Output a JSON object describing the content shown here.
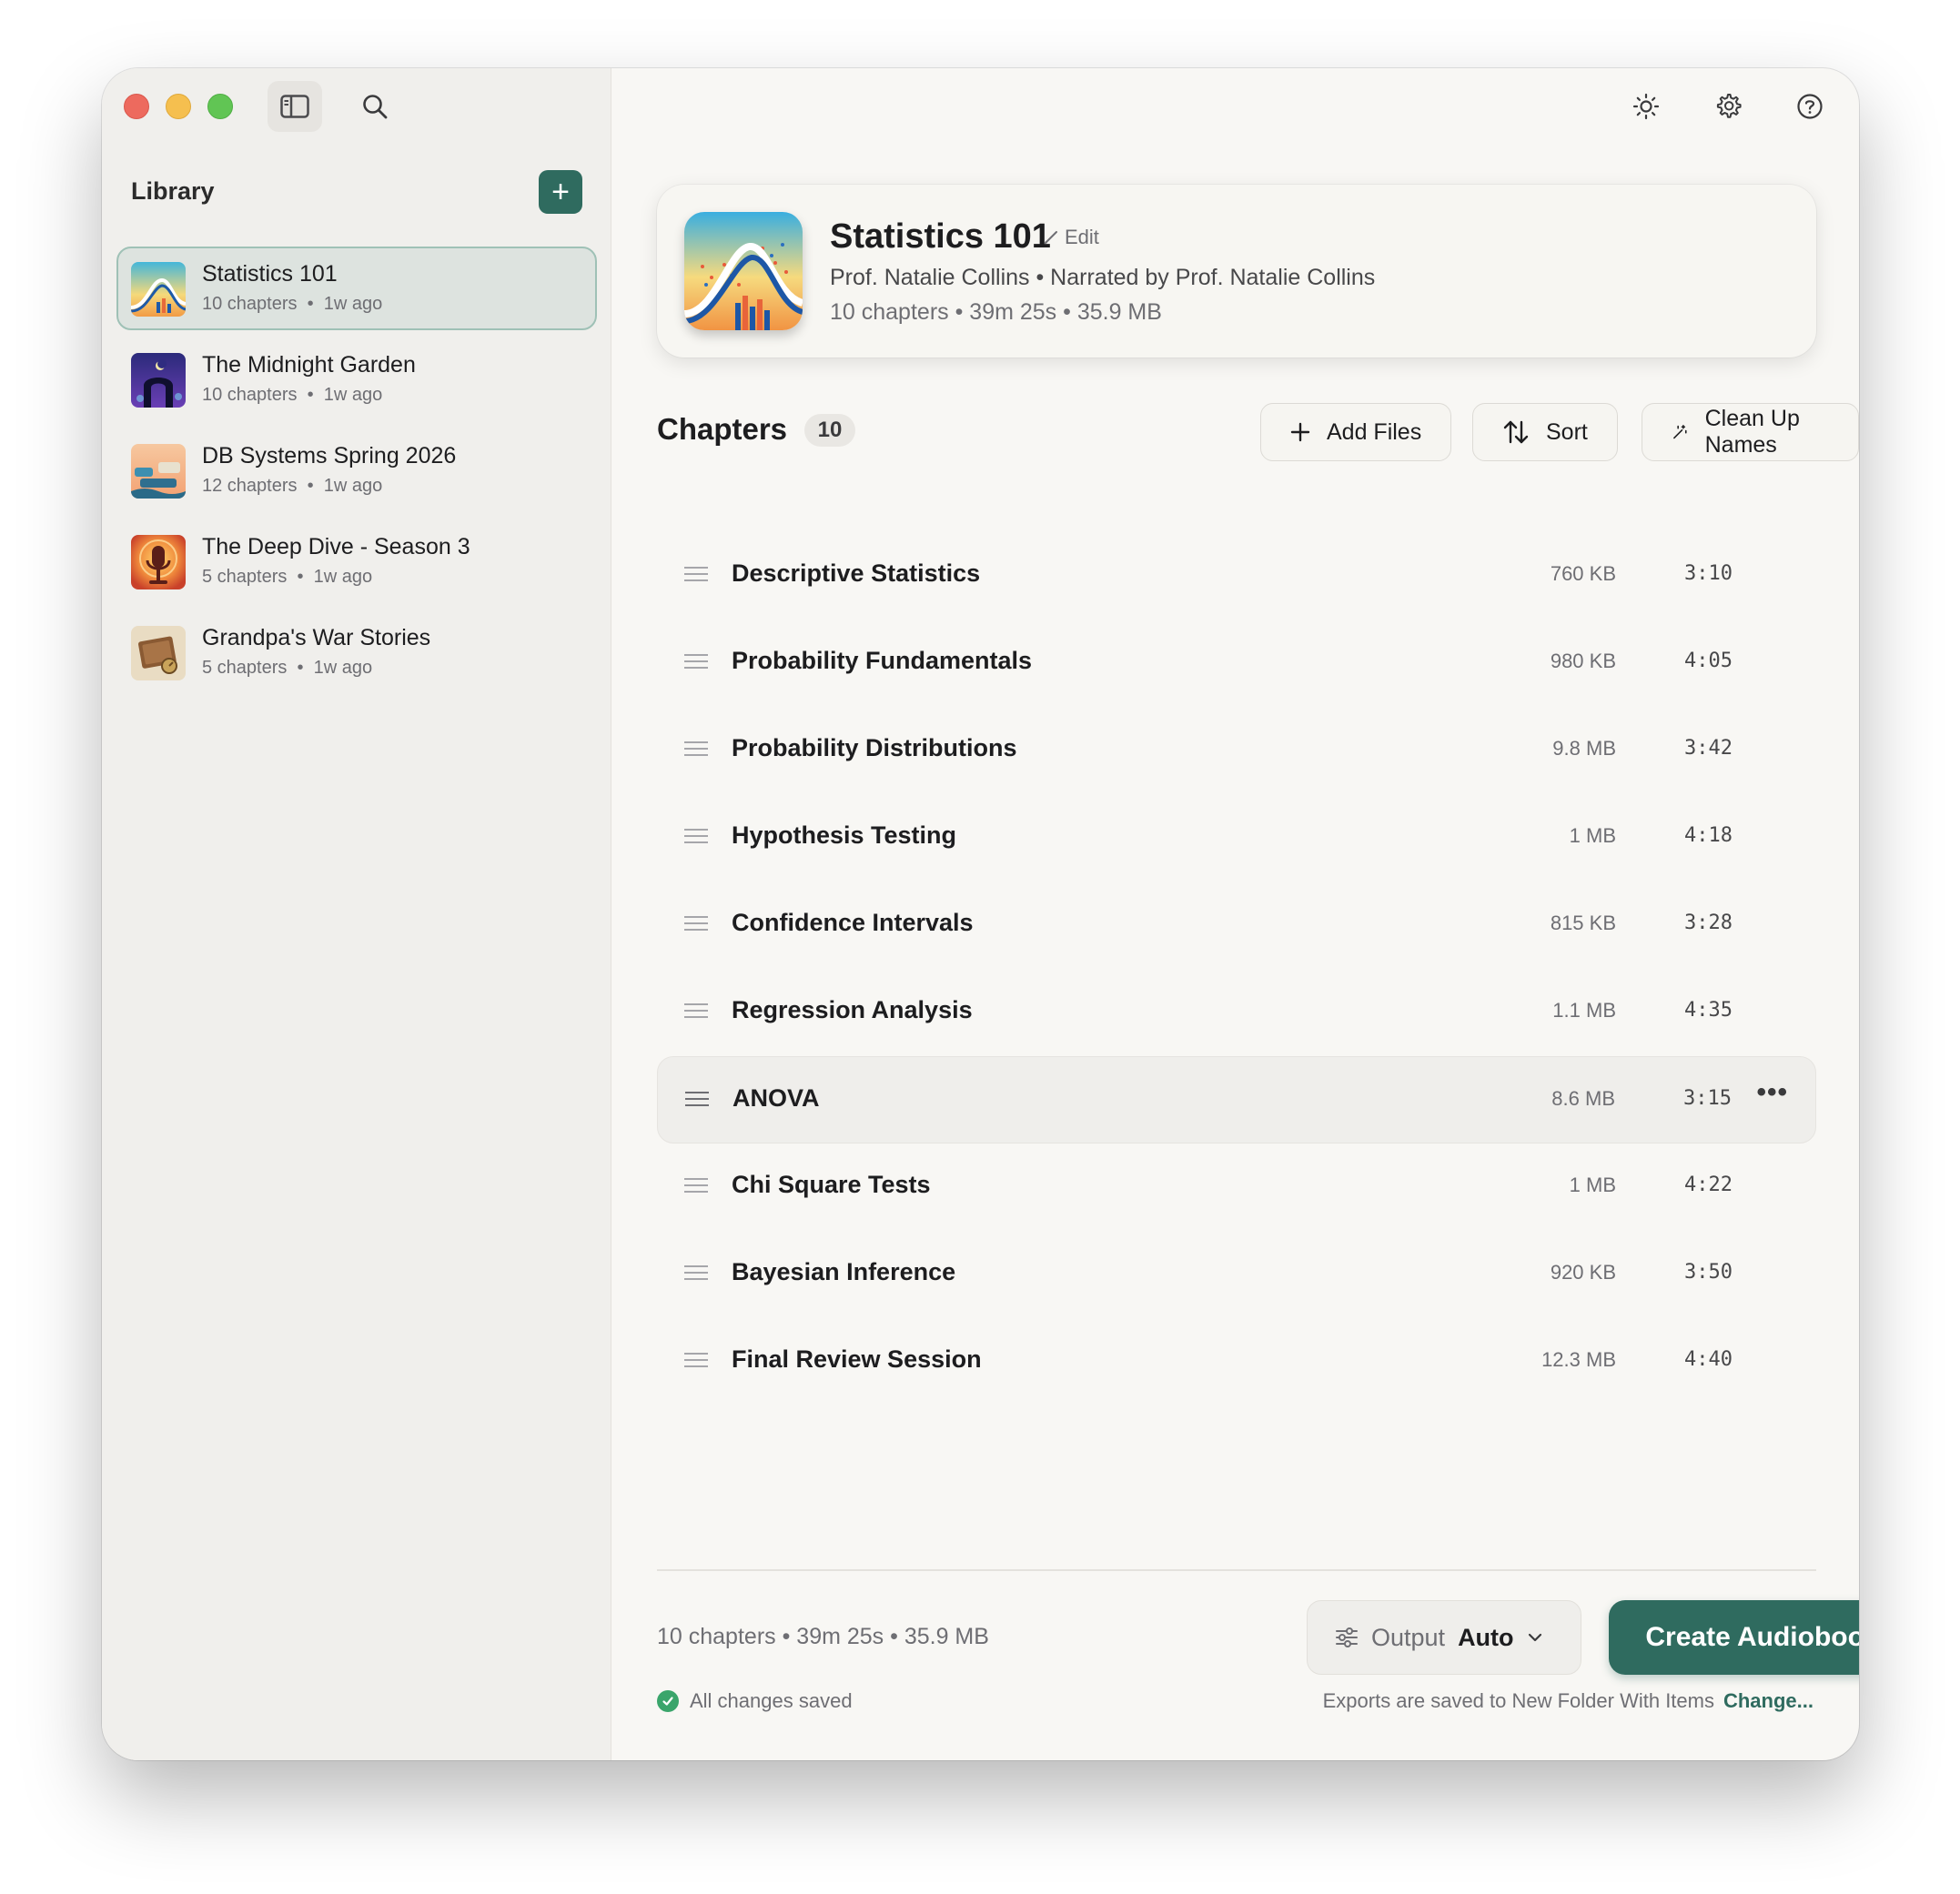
{
  "window": {
    "traffic_lights": [
      "close",
      "minimize",
      "zoom"
    ]
  },
  "toolbar": {
    "sidebar_icon": "sidebar-icon",
    "search_icon": "search-icon",
    "right_icons": [
      "sun-icon",
      "gear-icon",
      "help-icon"
    ]
  },
  "library": {
    "title": "Library",
    "add_label": "+",
    "items": [
      {
        "name": "Statistics 101",
        "chapters": "10 chapters",
        "when": "1w ago",
        "selected": true
      },
      {
        "name": "The Midnight Garden",
        "chapters": "10 chapters",
        "when": "1w ago"
      },
      {
        "name": "DB Systems Spring 2026",
        "chapters": "12 chapters",
        "when": "1w ago"
      },
      {
        "name": "The Deep Dive - Season 3",
        "chapters": "5 chapters",
        "when": "1w ago"
      },
      {
        "name": "Grandpa's War Stories",
        "chapters": "5 chapters",
        "when": "1w ago"
      }
    ]
  },
  "book": {
    "title": "Statistics 101",
    "edit_label": "Edit",
    "authors": "Prof. Natalie Collins • Narrated by Prof. Natalie Collins",
    "meta": "10 chapters • 39m 25s • 35.9 MB"
  },
  "chapters": {
    "heading": "Chapters",
    "count": "10",
    "add_files": "Add Files",
    "sort": "Sort",
    "clean_up": "Clean Up Names",
    "rows": [
      {
        "title": "Descriptive Statistics",
        "size": "760 KB",
        "duration": "3:10"
      },
      {
        "title": "Probability Fundamentals",
        "size": "980 KB",
        "duration": "4:05"
      },
      {
        "title": "Probability Distributions",
        "size": "9.8 MB",
        "duration": "3:42"
      },
      {
        "title": "Hypothesis Testing",
        "size": "1 MB",
        "duration": "4:18"
      },
      {
        "title": "Confidence Intervals",
        "size": "815 KB",
        "duration": "3:28"
      },
      {
        "title": "Regression Analysis",
        "size": "1.1 MB",
        "duration": "4:35"
      },
      {
        "title": "ANOVA",
        "size": "8.6 MB",
        "duration": "3:15",
        "hover": true,
        "more": "•••"
      },
      {
        "title": "Chi Square Tests",
        "size": "1 MB",
        "duration": "4:22"
      },
      {
        "title": "Bayesian Inference",
        "size": "920 KB",
        "duration": "3:50"
      },
      {
        "title": "Final Review Session",
        "size": "12.3 MB",
        "duration": "4:40"
      }
    ]
  },
  "footer": {
    "meta": "10 chapters • 39m 25s • 35.9 MB",
    "output_label": "Output",
    "output_value": "Auto",
    "create_label": "Create Audiobook",
    "saved_label": "All changes saved",
    "exports_text": "Exports are saved to New Folder With Items",
    "change_label": "Change..."
  },
  "colors": {
    "accent": "#2f6b5f",
    "selected_bg": "#dde3df",
    "saved_green": "#3aa56b"
  }
}
